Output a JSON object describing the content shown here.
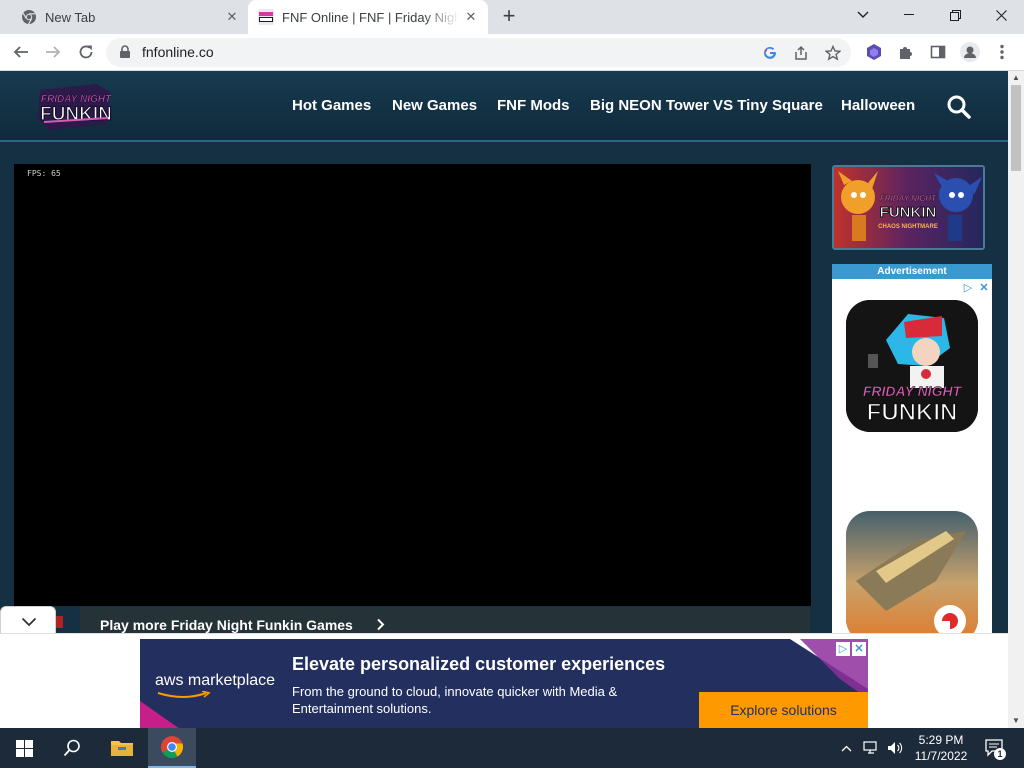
{
  "browser": {
    "tabs": [
      {
        "title": "New Tab"
      },
      {
        "title": "FNF Online | FNF | Friday Night Funkin"
      }
    ],
    "address": "fnfonline.co",
    "tab_icons": [
      "chrome-icon",
      "fnf-favicon"
    ],
    "toolbar_icons": [
      "back-icon",
      "forward-icon",
      "reload-icon",
      "google-lens-icon",
      "share-icon",
      "star-icon",
      "extension-icon",
      "puzzle-icon",
      "side-panel-icon",
      "profile-icon",
      "menu-icon"
    ]
  },
  "site": {
    "logo_text": "Friday Night Funkin",
    "nav": [
      "Hot Games",
      "New Games",
      "FNF Mods",
      "Big NEON Tower VS Tiny Square",
      "Halloween"
    ],
    "fps": "FPS: 65",
    "play_more": "Play more Friday Night Funkin Games",
    "thumb_sub": "CHAOS NIGHTMARE",
    "ad_label": "Advertisement"
  },
  "bottom_ad": {
    "brand": "aws marketplace",
    "headline": "Elevate personalized customer experiences",
    "body": "From the ground to cloud, innovate quicker with Media & Entertainment solutions.",
    "cta": "Explore solutions"
  },
  "taskbar": {
    "time": "5:29 PM",
    "date": "11/7/2022",
    "notifications": "1"
  },
  "colors": {
    "site_header": "#173a50",
    "page_bg": "#143042",
    "ad_label": "#3a9ad0",
    "aws_bg": "#232f5e",
    "aws_cta": "#ff9900",
    "taskbar": "#1c2a3a"
  }
}
